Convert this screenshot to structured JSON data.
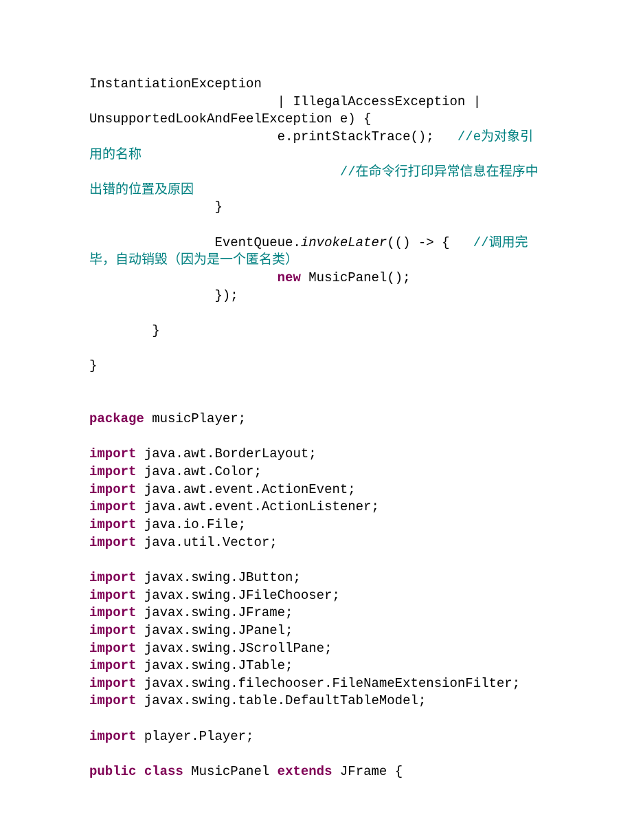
{
  "code": {
    "l1a": "InstantiationException",
    "l2a": "\t\t\t| IllegalAccessException | UnsupportedLookAndFeelException e) {",
    "l3a": "\t\t\te.printStackTrace();   ",
    "l3b": "//e为对象引用的名称",
    "l4a": "                                ",
    "l4b": "//在命令行打印异常信息在程序中出错的位置及原因",
    "l5": "\t\t}",
    "blank1": "",
    "l6a": "\t\tEventQueue.",
    "l6b": "invokeLater",
    "l6c": "(() -> {   ",
    "l6d": "//调用完毕，自动销毁（因为是一个匿名类）",
    "l7a": "\t\t\t",
    "l7_kw": "new",
    "l7b": " MusicPanel();",
    "l8": "\t\t});",
    "blank2": "",
    "l9": "\t}",
    "blank3": "",
    "l10": "}",
    "blank4": "",
    "blank5": "",
    "pkg_kw": "package",
    "pkg": " musicPlayer;",
    "blank6": "",
    "im1_kw": "import",
    "im1": " java.awt.BorderLayout;",
    "im2_kw": "import",
    "im2": " java.awt.Color;",
    "im3_kw": "import",
    "im3": " java.awt.event.ActionEvent;",
    "im4_kw": "import",
    "im4": " java.awt.event.ActionListener;",
    "im5_kw": "import",
    "im5": " java.io.File;",
    "im6_kw": "import",
    "im6": " java.util.Vector;",
    "blank7": "",
    "im7_kw": "import",
    "im7": " javax.swing.JButton;",
    "im8_kw": "import",
    "im8": " javax.swing.JFileChooser;",
    "im9_kw": "import",
    "im9": " javax.swing.JFrame;",
    "im10_kw": "import",
    "im10": " javax.swing.JPanel;",
    "im11_kw": "import",
    "im11": " javax.swing.JScrollPane;",
    "im12_kw": "import",
    "im12": " javax.swing.JTable;",
    "im13_kw": "import",
    "im13": " javax.swing.filechooser.FileNameExtensionFilter;",
    "im14_kw": "import",
    "im14": " javax.swing.table.DefaultTableModel;",
    "blank8": "",
    "im15_kw": "import",
    "im15": " player.Player;",
    "blank9": "",
    "cls_kw1": "public",
    "cls_sp1": " ",
    "cls_kw2": "class",
    "cls_name": " MusicPanel ",
    "cls_kw3": "extends",
    "cls_tail": " JFrame {"
  }
}
